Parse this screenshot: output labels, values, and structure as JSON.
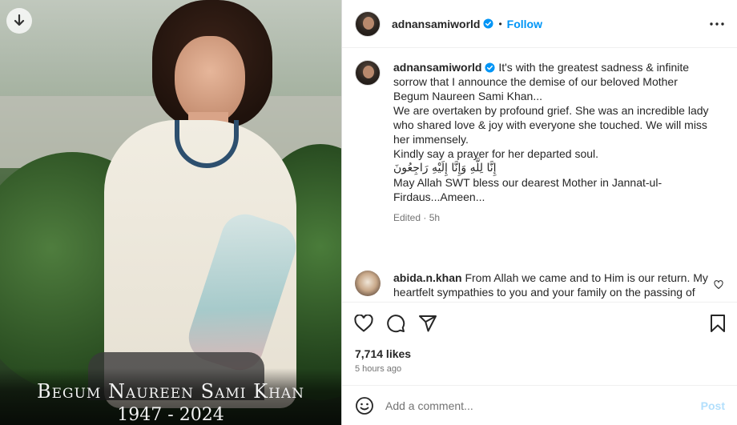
{
  "photo": {
    "name_text": "Begum Naureen Sami Khan",
    "years_text": "1947 - 2024",
    "download_icon": "download-arrow-icon"
  },
  "header": {
    "username": "adnansamiworld",
    "separator": "•",
    "follow_label": "Follow",
    "verified_icon": "verified-badge-icon",
    "more_icon": "more-options-icon"
  },
  "caption": {
    "username": "adnansamiworld",
    "line1": "It's with the greatest sadness & infinite sorrow that I announce the demise of our beloved Mother Begum Naureen Sami Khan...",
    "line2": "We are overtaken by profound grief. She was an incredible lady who shared love & joy with everyone she touched. We will miss her immensely.",
    "line3": "Kindly say a prayer for her departed soul.",
    "arabic": "إِنَّا لِلَّهِ وَإِنَّا إِلَيْهِ رَاجِعُونَ",
    "line4": "May Allah SWT bless our dearest Mother in Jannat-ul-Firdaus...Ameen...",
    "meta": "Edited · 5h"
  },
  "comment": {
    "username": "abida.n.khan",
    "text": "From Allah we came and to Him is our return. My heartfelt sympathies to you and your family on the passing of",
    "like_icon": "heart-outline-icon"
  },
  "actions": {
    "like_icon": "heart-icon",
    "comment_icon": "comment-bubble-icon",
    "share_icon": "paper-plane-icon",
    "save_icon": "bookmark-icon"
  },
  "stats": {
    "likes": "7,714 likes",
    "time": "5 hours ago"
  },
  "add_comment": {
    "emoji_icon": "emoji-smiley-icon",
    "placeholder": "Add a comment...",
    "post_label": "Post"
  },
  "colors": {
    "accent": "#0095f6",
    "post_disabled": "#b2dffc",
    "muted": "#737373"
  }
}
